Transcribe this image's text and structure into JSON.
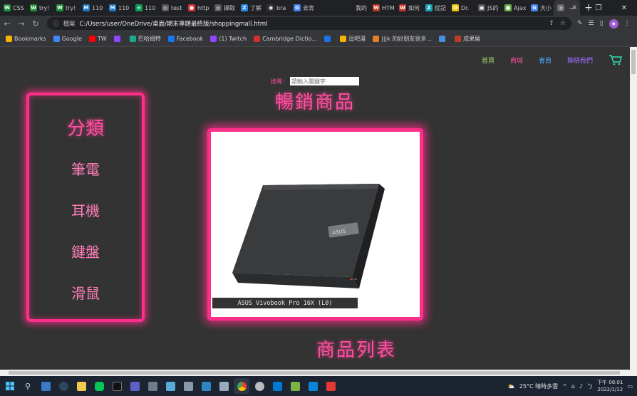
{
  "browser": {
    "tabs": [
      {
        "label": "CSS",
        "fav_color": "#1f8f3a",
        "fav": "W"
      },
      {
        "label": "try!",
        "fav_color": "#1f8f3a",
        "fav": "W"
      },
      {
        "label": "try!",
        "fav_color": "#1f8f3a",
        "fav": "W"
      },
      {
        "label": "110",
        "fav_color": "#1a7bc8",
        "fav": "M"
      },
      {
        "label": "110",
        "fav_color": "#1a7bc8",
        "fav": "M"
      },
      {
        "label": "110",
        "fav_color": "#0f9d58",
        "fav": "+"
      },
      {
        "label": "test",
        "fav_color": "#555555",
        "fav": "◎"
      },
      {
        "label": "http",
        "fav_color": "#d33",
        "fav": "●"
      },
      {
        "label": "擷取",
        "fav_color": "#555555",
        "fav": "◎"
      },
      {
        "label": "了解",
        "fav_color": "#2a8ae2",
        "fav": "Z"
      },
      {
        "label": "bra",
        "fav_color": "#333333",
        "fav": "◉"
      },
      {
        "label": "去背",
        "fav_color": "#4285f4",
        "fav": "G"
      },
      {
        "label": "",
        "fav_color": "#202124",
        "fav": ""
      },
      {
        "label": "我的",
        "fav_color": "#202124",
        "fav": ""
      },
      {
        "label": "HTM",
        "fav_color": "#c0392b",
        "fav": "W"
      },
      {
        "label": "如何",
        "fav_color": "#c0392b",
        "fav": "W"
      },
      {
        "label": "從記",
        "fav_color": "#17a2b8",
        "fav": "Z"
      },
      {
        "label": "Dr.",
        "fav_color": "#f1c40f",
        "fav": "D"
      },
      {
        "label": "JS的",
        "fav_color": "#555555",
        "fav": "▣"
      },
      {
        "label": "Ajax",
        "fav_color": "#6ab04c",
        "fav": "●"
      },
      {
        "label": "大小",
        "fav_color": "#4285f4",
        "fav": "G"
      },
      {
        "label": "",
        "fav_color": "#666666",
        "fav": "◎",
        "active": true
      }
    ],
    "new_tab": "+",
    "window_controls": {
      "minimize": "—",
      "restore": "❐",
      "close": "✕"
    },
    "address": {
      "scheme": "檔案",
      "url": "C:/Users/user/OneDrive/桌面/期末專題最終版/shoppingmall.html"
    },
    "bookmarks": [
      {
        "label": "Bookmarks",
        "icon": "grid-icon",
        "color": "#f4b400"
      },
      {
        "label": "Google",
        "icon": "google-icon",
        "color": "#4285f4"
      },
      {
        "label": "TW",
        "icon": "youtube-icon",
        "color": "#ff0000"
      },
      {
        "label": "",
        "icon": "twitch-icon",
        "color": "#9146ff"
      },
      {
        "label": "巴哈姆特",
        "icon": "baha-icon",
        "color": "#1aab8a"
      },
      {
        "label": "Facebook",
        "icon": "facebook-icon",
        "color": "#1877f2"
      },
      {
        "label": "(1) Twitch",
        "icon": "twitch-icon",
        "color": "#9146ff"
      },
      {
        "label": "Cambridge Dictio...",
        "icon": "cambridge-icon",
        "color": "#d0312d"
      },
      {
        "label": "",
        "icon": "gmail-icon",
        "color": "#1a73e8"
      },
      {
        "label": "逗吧漫",
        "icon": "comic-icon",
        "color": "#f4b400"
      },
      {
        "label": "|||k 的好朋友很多...",
        "icon": "book-icon",
        "color": "#e67e22"
      },
      {
        "label": "",
        "icon": "docs-icon",
        "color": "#4a90e2"
      },
      {
        "label": "成果展",
        "icon": "record-icon",
        "color": "#c0392b"
      }
    ]
  },
  "page": {
    "nav": [
      "首頁",
      "商城",
      "會員",
      "聯絡我們"
    ],
    "search_label": "搜尋：",
    "search_placeholder": "請輸入關鍵字",
    "best_sellers_title": "暢銷商品",
    "categories_title": "分類",
    "categories": [
      "筆電",
      "耳機",
      "鍵盤",
      "滑鼠"
    ],
    "featured_product": "ASUS Vivobook Pro 16X (L0)",
    "product_list_title": "商品列表"
  },
  "taskbar": {
    "weather": "25°C 晴時多雲",
    "ime": "ㄅ",
    "time": "下午 08:01",
    "date": "2022/1/12"
  }
}
